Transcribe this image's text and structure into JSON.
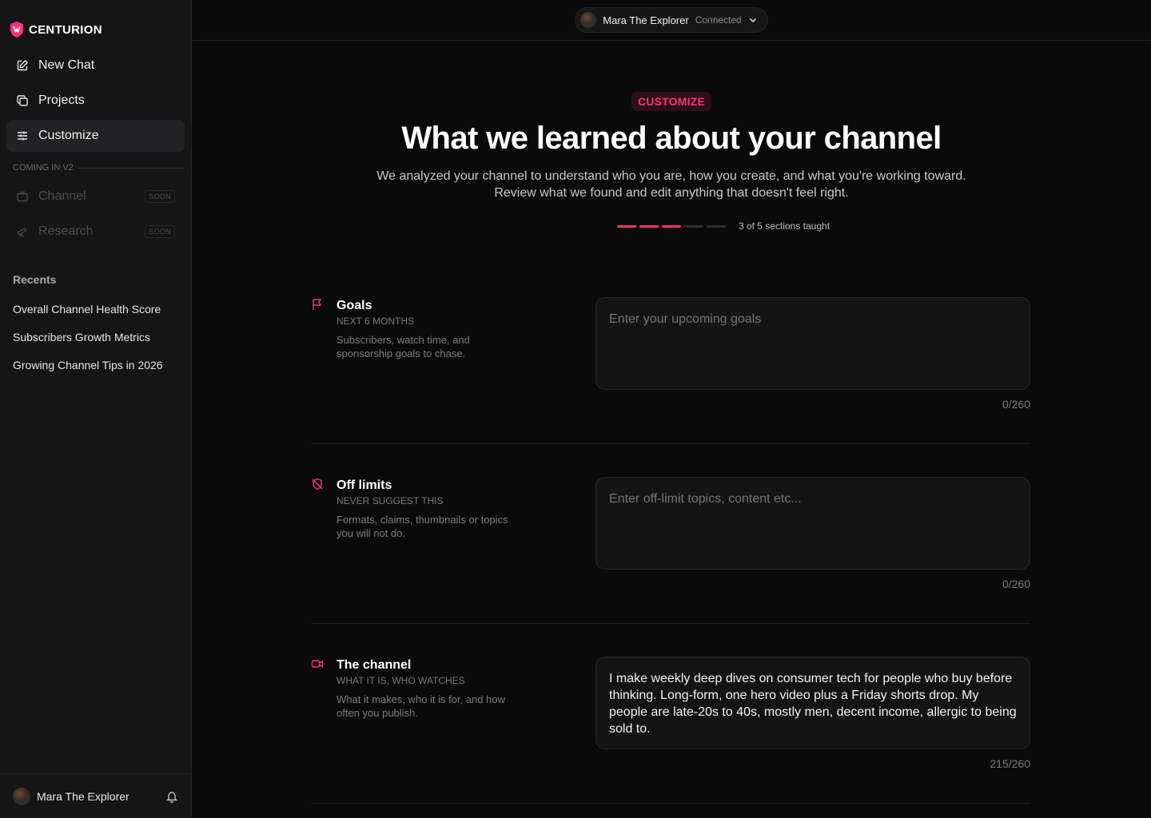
{
  "brand": {
    "name": "CENTURION",
    "accent": "#ff2e7e"
  },
  "nav": {
    "new_chat": "New Chat",
    "projects": "Projects",
    "customize": "Customize",
    "coming_label": "COMING IN V2",
    "channel": "Channel",
    "research": "Research",
    "soon": "SOON"
  },
  "recents": {
    "title": "Recents",
    "items": [
      "Overall Channel Health Score",
      "Subscribers Growth Metrics",
      "Growing Channel Tips in 2026"
    ]
  },
  "footer": {
    "user_name": "Mara The Explorer"
  },
  "topbar": {
    "channel_name": "Mara The Explorer",
    "status": "Connected"
  },
  "hero": {
    "badge": "CUSTOMIZE",
    "title": "What we learned about your channel",
    "subtitle_line1": "We analyzed your channel to understand who you are, how you create, and what you're working toward.",
    "subtitle_line2": "Review what we found and edit anything that doesn't feel right.",
    "progress_label": "3 of 5 sections taught",
    "progress_done": 3,
    "progress_total": 5
  },
  "sections": [
    {
      "icon": "flag-icon",
      "title": "Goals",
      "kicker": "NEXT 6 MONTHS",
      "desc": "Subscribers, watch time, and sponsorship goals to chase.",
      "placeholder": "Enter your upcoming goals",
      "value": "",
      "counter": "0/260"
    },
    {
      "icon": "shield-off-icon",
      "title": "Off limits",
      "kicker": "NEVER SUGGEST THIS",
      "desc": "Formats, claims, thumbnails or topics you will not do.",
      "placeholder": "Enter off-limit topics, content etc...",
      "value": "",
      "counter": "0/260"
    },
    {
      "icon": "video-icon",
      "title": "The channel",
      "kicker": "WHAT IT IS, WHO WATCHES",
      "desc": "What it makes, who it is for, and how often you publish.",
      "placeholder": "",
      "value": "I make weekly deep dives on consumer tech for people who buy before thinking. Long-form, one hero video plus a Friday shorts drop. My people are late-20s to 40s, mostly men, decent income, allergic to being sold to.",
      "counter": "215/260"
    }
  ]
}
